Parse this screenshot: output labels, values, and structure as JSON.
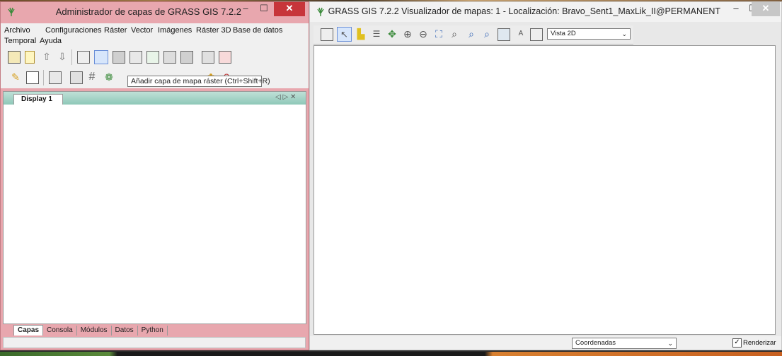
{
  "layer_manager": {
    "title": "Administrador de capas de GRASS GIS 7.2.2",
    "menu": [
      "Archivo",
      "Configuraciones",
      "Ráster",
      "Vector",
      "Imágenes",
      "Ráster 3D",
      "Base de datos",
      "Temporal",
      "Ayuda"
    ],
    "tooltip": "Añadir capa de mapa ráster (Ctrl+Shift+R)",
    "display_tab": "Display 1",
    "display_tab_controls": "◁ ▷ ✕",
    "bottom_tabs": [
      "Capas",
      "Consola",
      "Módulos",
      "Datos",
      "Python"
    ],
    "active_bottom_tab": "Capas"
  },
  "map_display": {
    "title": "GRASS GIS 7.2.2 Visualizador de mapas: 1 - Localización: Bravo_Sent1_MaxLik_II@PERMANENT",
    "view_mode": "Vista 2D",
    "status_mode": "Coordenadas",
    "render_label": "Renderizar",
    "render_checked": true
  },
  "window_controls": {
    "minimize": "–",
    "maximize": "☐",
    "close": "✕"
  },
  "colors": {
    "accent_left_titlebar": "#e8a7ae",
    "close_red": "#c7353a",
    "tab_strip": "#8ec8b8"
  }
}
